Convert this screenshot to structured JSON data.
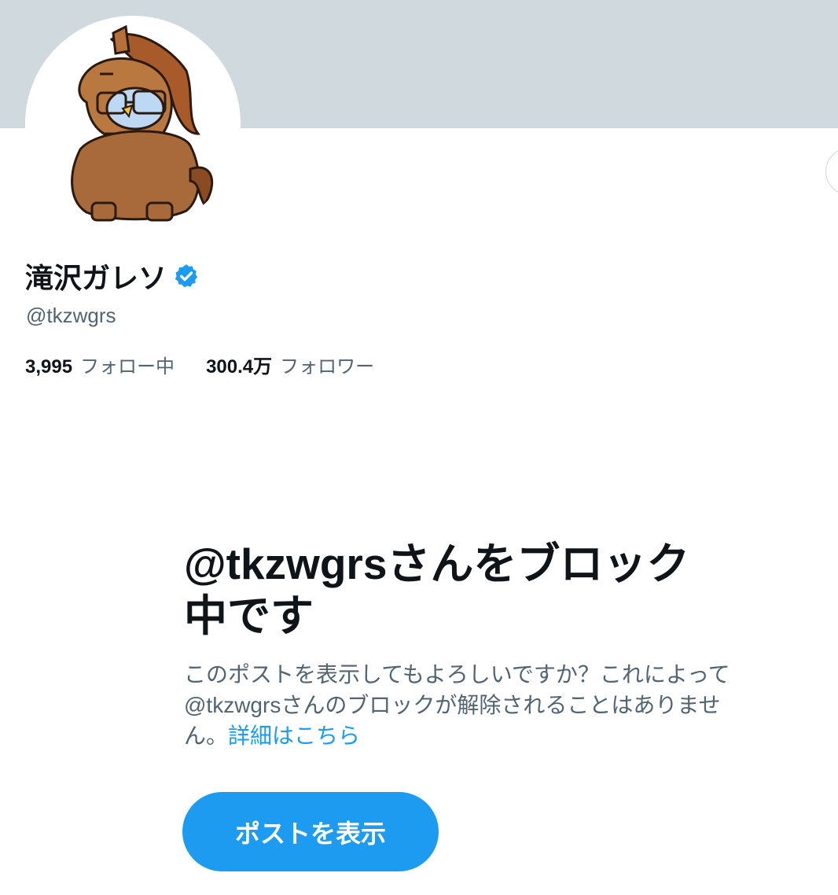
{
  "profile": {
    "display_name": "滝沢ガレソ",
    "verified_icon": "verified-badge-icon",
    "handle": "@tkzwgrs",
    "avatar_icon": "horse-mascot-avatar"
  },
  "stats": {
    "following_count": "3,995",
    "following_label": "フォロー中",
    "followers_count": "300.4万",
    "followers_label": "フォロワー"
  },
  "blocked_notice": {
    "title": "@tkzwgrsさんをブロック中です",
    "description": "このポストを表示してもよろしいですか？これによって@tkzwgrsさんのブロックが解除されることはありません。",
    "learn_more": "詳細はこちら",
    "view_button": "ポストを表示"
  },
  "colors": {
    "banner": "#cfd9de",
    "accent": "#1d9bf0",
    "text_primary": "#0f1419",
    "text_secondary": "#536471"
  }
}
